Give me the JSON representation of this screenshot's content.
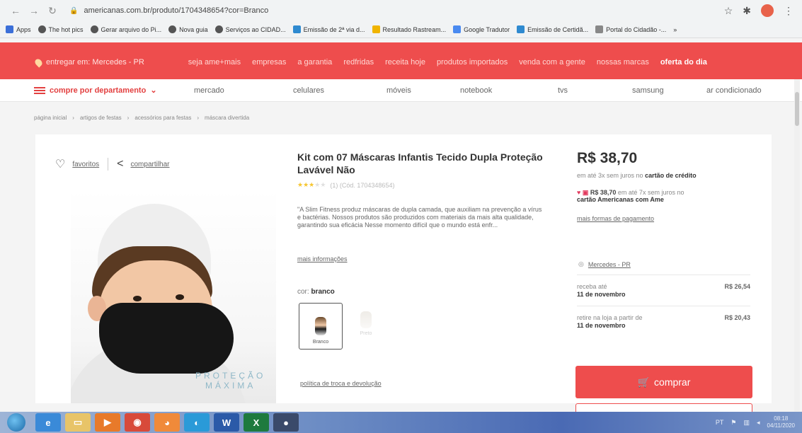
{
  "browser": {
    "url": "americanas.com.br/produto/1704348654?cor=Branco",
    "bookmarks": [
      {
        "label": "Apps",
        "color": "#3b6fd8"
      },
      {
        "label": "The hot pics",
        "color": "#555555"
      },
      {
        "label": "Gerar arquivo do Pi...",
        "color": "#555555"
      },
      {
        "label": "Nova guia",
        "color": "#555555"
      },
      {
        "label": "Serviços ao CIDAD...",
        "color": "#555555"
      },
      {
        "label": "Emissão de 2ª via d...",
        "color": "#2f8ad0"
      },
      {
        "label": "Resultado Rastream...",
        "color": "#f0b400"
      },
      {
        "label": "Google Tradutor",
        "color": "#4a8af0"
      },
      {
        "label": "Emissão de Certidã...",
        "color": "#2f8ad0"
      },
      {
        "label": "Portal do Cidadão -...",
        "color": "#888888"
      }
    ],
    "more_bookmarks": "»"
  },
  "header": {
    "deliver_label": "entregar em: Mercedes - PR",
    "links": [
      "seja ame+mais",
      "empresas",
      "a garantia",
      "redfridas",
      "receita hoje",
      "produtos importados",
      "venda com a gente",
      "nossas marcas",
      "oferta do dia"
    ]
  },
  "departments": {
    "button_label": "compre por departamento",
    "items": [
      "mercado",
      "celulares",
      "móveis",
      "notebook",
      "tvs",
      "samsung",
      "ar condicionado"
    ]
  },
  "breadcrumb": [
    "página inicial",
    "artigos de festas",
    "acessórios para festas",
    "máscara divertida"
  ],
  "product": {
    "favorites_label": "favoritos",
    "share_label": "compartilhar",
    "image_overlay": [
      "PROTEÇÃO",
      "MÁXIMA"
    ],
    "title": "Kit com 07 Máscaras Infantis Tecido Dupla Proteção Lavável Não",
    "rating": 3,
    "rating_meta": "(1) (Cód. 1704348654)",
    "description": "\"A Slim Fitness produz máscaras de dupla camada, que auxiliam na prevenção a vírus e bactérias. Nossos produtos são produzidos com materiais da mais alta qualidade, garantindo sua eficácia Nesse momento difícil que o mundo está enfr...",
    "more_info": "mais informações",
    "color_label": "cor:",
    "color_value": "branco",
    "swatches": [
      "Branco",
      "Preto"
    ],
    "policy": "política de troca e devolução"
  },
  "purchase": {
    "price": "R$ 38,70",
    "installments_prefix": "em até 3x sem juros no",
    "installments_card": "cartão de crédito",
    "ame_price": "R$ 38,70",
    "ame_mid": "em até 7x sem juros no",
    "ame_card": "cartão Americanas com Ame",
    "more_payment": "mais formas de pagamento",
    "location": "Mercedes - PR",
    "shipping": [
      {
        "label": "receba até",
        "date": "11 de novembro",
        "price": "R$ 26,54"
      },
      {
        "label": "retire na loja a partir de",
        "date": "11 de novembro",
        "price": "R$ 20,43"
      }
    ],
    "buy_label": "comprar"
  },
  "taskbar": {
    "lang": "PT",
    "time": "08:18",
    "date": "04/11/2020"
  }
}
